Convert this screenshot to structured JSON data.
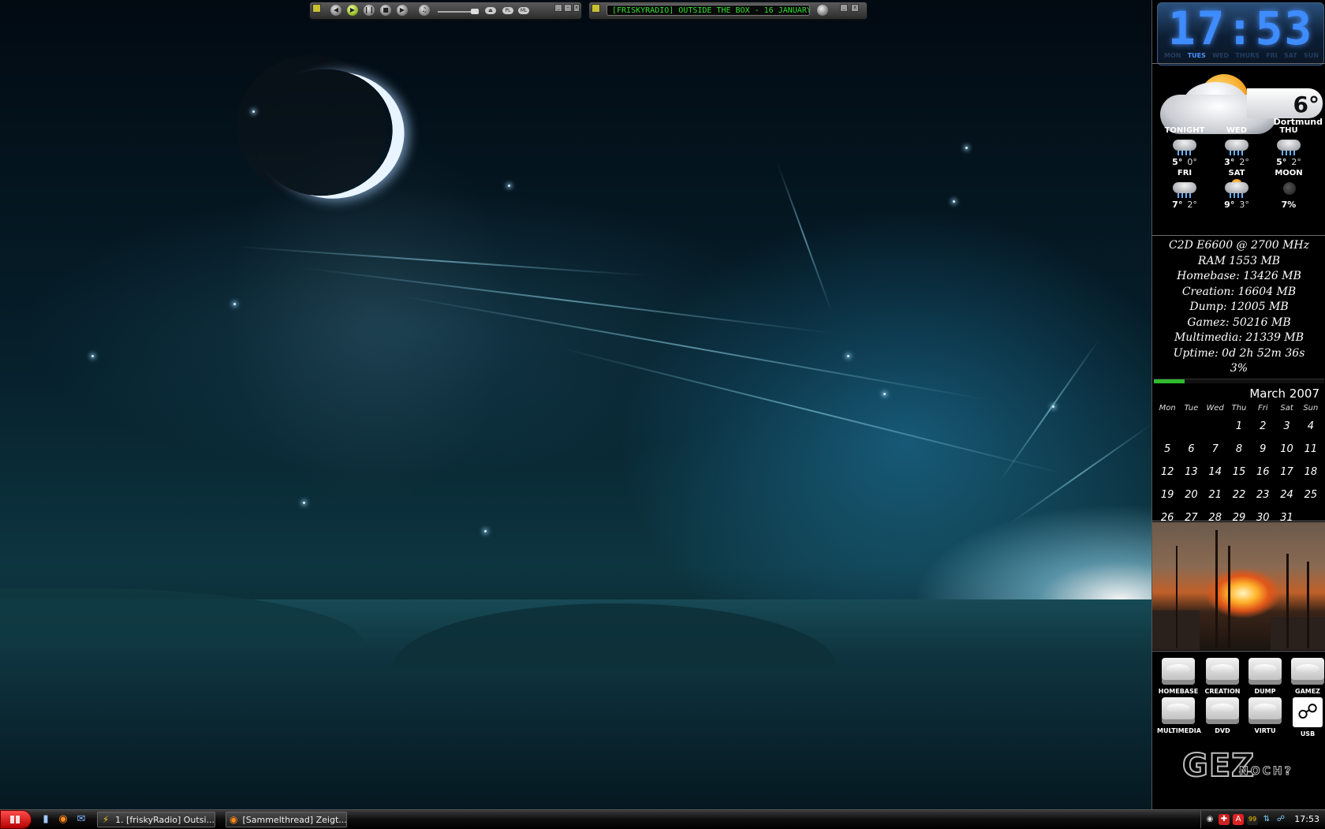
{
  "winamp": {
    "controls": [
      "prev",
      "play",
      "pause",
      "stop",
      "next"
    ],
    "buttons": {
      "eject": "",
      "pl": "PL",
      "ml": "ML"
    },
    "track_text": "[FRISKYRADIO] OUTSIDE THE BOX - 16 JANUARY",
    "volume_level": 0.85
  },
  "clock": {
    "time": "17:53",
    "days": [
      "MON",
      "TUES",
      "WED",
      "THURS",
      "FRI",
      "SAT",
      "SUN"
    ],
    "active_day_index": 1
  },
  "weather": {
    "current_temp": "6°",
    "city": "Dortmund",
    "forecast": [
      {
        "name": "TONIGHT",
        "hi": "5°",
        "lo": "0°",
        "icon": "rain-cloud-icon"
      },
      {
        "name": "WED",
        "hi": "3°",
        "lo": "2°",
        "icon": "rain-cloud-icon"
      },
      {
        "name": "THU",
        "hi": "5°",
        "lo": "2°",
        "icon": "rain-cloud-icon"
      },
      {
        "name": "FRI",
        "hi": "7°",
        "lo": "2°",
        "icon": "rain-cloud-icon"
      },
      {
        "name": "SAT",
        "hi": "9°",
        "lo": "3°",
        "icon": "sun-rain-icon"
      },
      {
        "name": "MOON",
        "value": "7%",
        "icon": "moon-icon"
      }
    ]
  },
  "sysinfo": {
    "lines": [
      "C2D E6600 @ 2700 MHz",
      "RAM 1553 MB",
      "Homebase: 13426 MB",
      "Creation: 16604 MB",
      "Dump: 12005 MB",
      "Gamez: 50216 MB",
      "Multimedia: 21339 MB",
      "Uptime: 0d 2h 52m 36s"
    ],
    "cpu_percent": "3%",
    "cpu_fraction": 0.03
  },
  "calendar": {
    "title": "March 2007",
    "weekdays": [
      "Mon",
      "Tue",
      "Wed",
      "Thu",
      "Fri",
      "Sat",
      "Sun"
    ],
    "leading_blanks": 3,
    "days": [
      "1",
      "2",
      "3",
      "4",
      "5",
      "6",
      "7",
      "8",
      "9",
      "10",
      "11",
      "12",
      "13",
      "14",
      "15",
      "16",
      "17",
      "18",
      "19",
      "20",
      "21",
      "22",
      "23",
      "24",
      "25",
      "26",
      "27",
      "28",
      "29",
      "30",
      "31"
    ]
  },
  "drives": [
    {
      "label": "HOMEBASE",
      "icon": "hdd-icon"
    },
    {
      "label": "CREATION",
      "icon": "hdd-icon"
    },
    {
      "label": "DUMP",
      "icon": "hdd-icon"
    },
    {
      "label": "GAMEZ",
      "icon": "hdd-icon"
    },
    {
      "label": "MULTIMEDIA",
      "icon": "hdd-icon"
    },
    {
      "label": "DVD",
      "icon": "dvd-icon"
    },
    {
      "label": "VIRTU",
      "icon": "hdd-icon"
    },
    {
      "label": "USB",
      "icon": "usb-icon"
    }
  ],
  "gez": {
    "big": "GEZ",
    "small": "NOCH?"
  },
  "taskbar": {
    "tasks": [
      {
        "label": "1. [friskyRadio] Outsi...",
        "icon": "winamp-icon"
      },
      {
        "label": "[Sammelthread] Zeigt...",
        "icon": "firefox-icon"
      }
    ],
    "tray_badge": "99",
    "clock": "17:53"
  },
  "colors": {
    "clock_blue": "#3e8cff",
    "lcd_green": "#2ee02e",
    "cpu_bar": "#2fbb2f",
    "start_red": "#d10000"
  }
}
